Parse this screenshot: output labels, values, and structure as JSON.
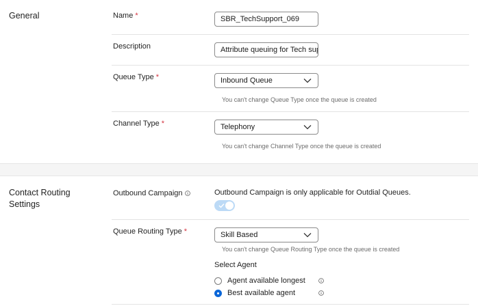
{
  "general": {
    "section_title": "General",
    "name": {
      "label": "Name",
      "required": "*",
      "value": "SBR_TechSupport_069"
    },
    "description": {
      "label": "Description",
      "value": "Attribute queuing for Tech sup"
    },
    "queue_type": {
      "label": "Queue Type",
      "required": "*",
      "selected": "Inbound Queue",
      "hint": "You can't change Queue Type once the queue is created"
    },
    "channel_type": {
      "label": "Channel Type",
      "required": "*",
      "selected": "Telephony",
      "hint": "You can't change Channel Type once the queue is created"
    }
  },
  "contact_routing": {
    "section_title_line1": "Contact Routing",
    "section_title_line2": "Settings",
    "outbound_campaign": {
      "label": "Outbound Campaign",
      "info_icon": "info-icon",
      "message": "Outbound Campaign is only applicable for Outdial Queues.",
      "toggle_on": true
    },
    "queue_routing_type": {
      "label": "Queue Routing Type",
      "required": "*",
      "selected": "Skill Based",
      "hint": "You can't change Queue Routing Type once the queue is created"
    },
    "select_agent": {
      "label": "Select Agent",
      "options": [
        {
          "label": "Agent available longest",
          "selected": false
        },
        {
          "label": "Best available agent",
          "selected": true
        }
      ]
    }
  },
  "colors": {
    "required": "#d4333f",
    "accent": "#0a66d8",
    "toggle_bg": "#bcdaf6",
    "hint": "#6b6b6b"
  }
}
